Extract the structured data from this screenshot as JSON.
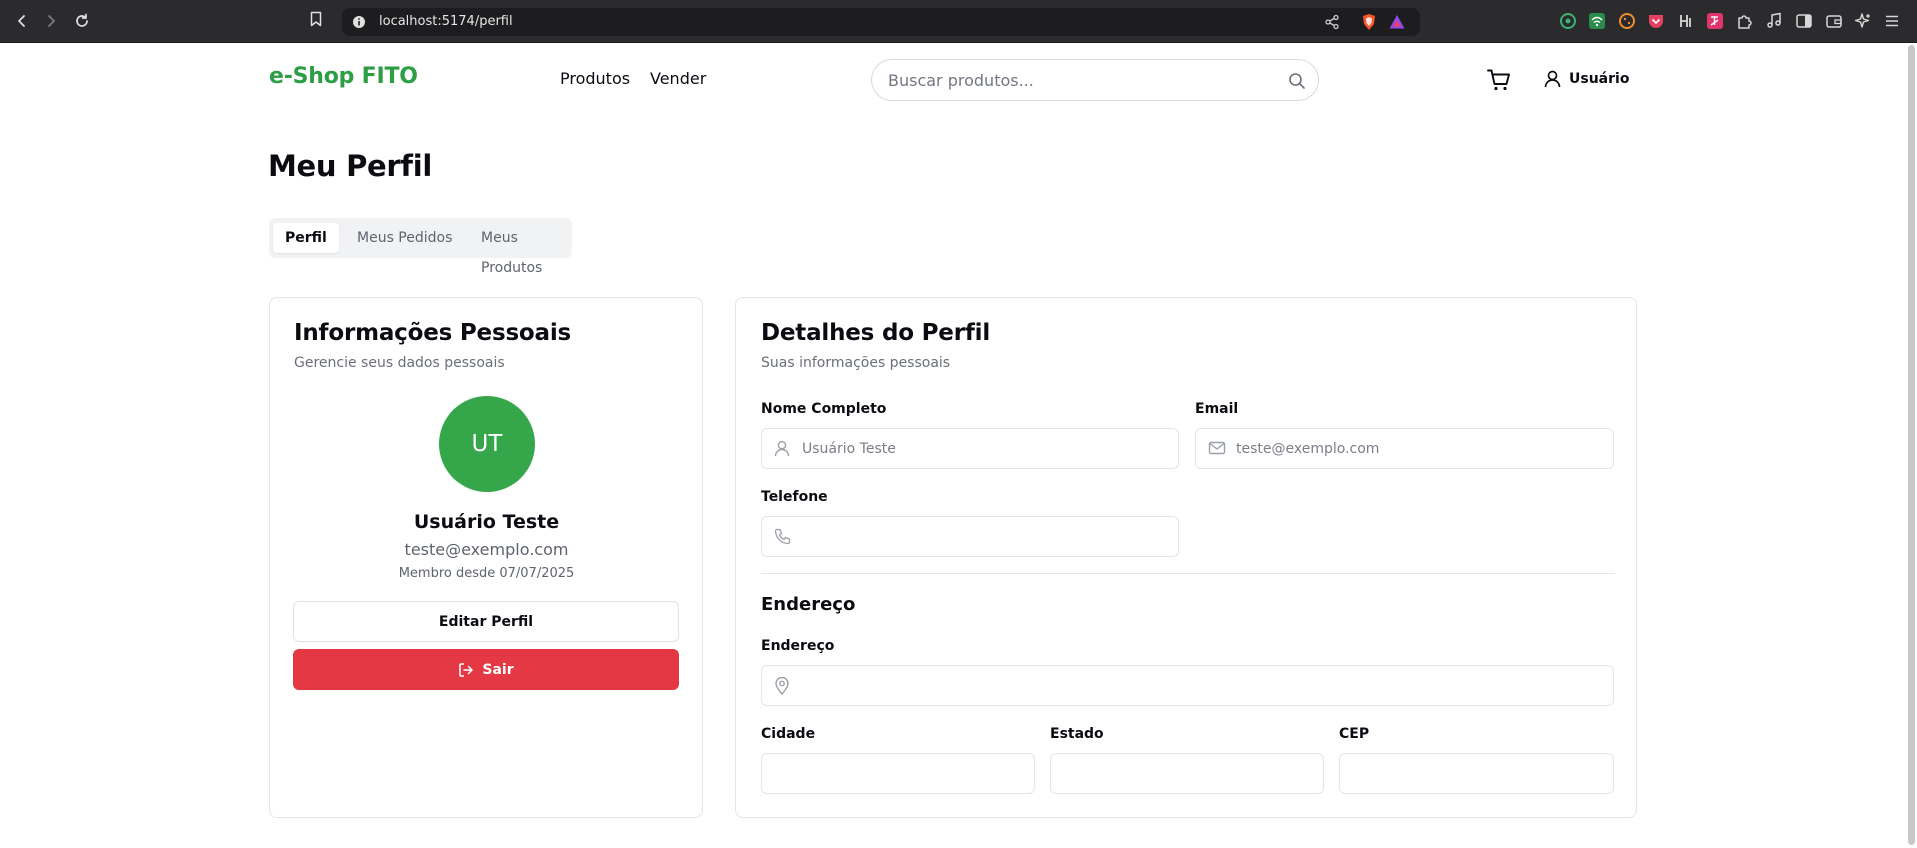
{
  "browser": {
    "url": "localhost:5174/perfil"
  },
  "header": {
    "logo": "e-Shop FITO",
    "nav": [
      "Produtos",
      "Vender"
    ],
    "search_placeholder": "Buscar produtos...",
    "user_label": "Usuário"
  },
  "page": {
    "title": "Meu Perfil",
    "tabs": [
      "Perfil",
      "Meus Pedidos",
      "Meus Produtos"
    ],
    "active_tab": "Perfil"
  },
  "personal_card": {
    "title": "Informações Pessoais",
    "subtitle": "Gerencie seus dados pessoais",
    "initials": "UT",
    "name": "Usuário Teste",
    "email": "teste@exemplo.com",
    "member_since": "Membro desde 07/07/2025",
    "edit_button": "Editar Perfil",
    "logout_button": "Sair"
  },
  "details_card": {
    "title": "Detalhes do Perfil",
    "subtitle": "Suas informações pessoais",
    "fields": {
      "name_label": "Nome Completo",
      "name_placeholder": "Usuário Teste",
      "email_label": "Email",
      "email_placeholder": "teste@exemplo.com",
      "phone_label": "Telefone",
      "phone_placeholder": ""
    },
    "address": {
      "section_title": "Endereço",
      "address_label": "Endereço",
      "city_label": "Cidade",
      "state_label": "Estado",
      "zip_label": "CEP"
    }
  },
  "colors": {
    "brand": "#2e9e45",
    "avatar": "#35a64a",
    "danger": "#e53845"
  }
}
